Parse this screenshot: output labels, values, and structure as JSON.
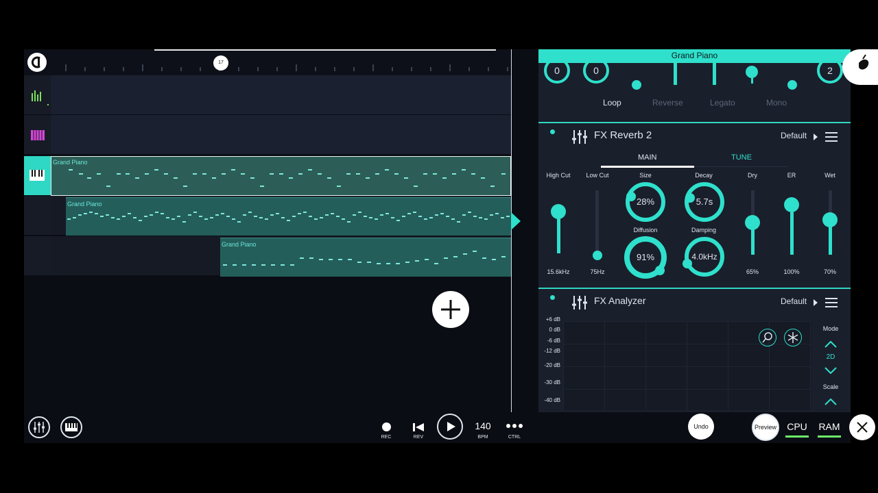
{
  "timeline": {
    "bar_marker": "17"
  },
  "playlist": {
    "clips": [
      {
        "label": "Grand Piano"
      },
      {
        "label": "Grand Piano"
      },
      {
        "label": "Grand Piano"
      }
    ]
  },
  "channel": {
    "title": "Grand Piano",
    "knob1": "0",
    "knob2": "0",
    "knob3": "2",
    "toggles": [
      "Loop",
      "Reverse",
      "Legato",
      "Mono"
    ]
  },
  "reverb": {
    "title": "FX Reverb 2",
    "preset": "Default",
    "tabs": [
      "MAIN",
      "TUNE"
    ],
    "high_cut": {
      "label": "High Cut",
      "value": "15.6kHz"
    },
    "low_cut": {
      "label": "Low Cut",
      "value": "75Hz"
    },
    "size": {
      "label": "Size",
      "value": "28%"
    },
    "decay": {
      "label": "Decay",
      "value": "5.7s"
    },
    "diffusion": {
      "label": "Diffusion",
      "value": "91%"
    },
    "damping": {
      "label": "Damping",
      "value": "4.0kHz"
    },
    "dry": {
      "label": "Dry",
      "value": "65%"
    },
    "er": {
      "label": "ER",
      "value": "100%"
    },
    "wet": {
      "label": "Wet",
      "value": "70%"
    }
  },
  "analyzer": {
    "title": "FX Analyzer",
    "preset": "Default",
    "db_labels": [
      "+6 dB",
      "0 dB",
      "-6 dB",
      "-12 dB",
      "-20 dB",
      "-30 dB",
      "-40 dB"
    ],
    "mode_label": "Mode",
    "mode_value": "2D",
    "scale_label": "Scale"
  },
  "transport": {
    "rec": "REC",
    "rev": "REV",
    "bpm_value": "140",
    "bpm": "BPM",
    "ctrl": "CTRL",
    "undo": "Undo",
    "preview": "Preview",
    "cpu": "CPU",
    "ram": "RAM"
  },
  "colors": {
    "accent": "#2fe0cc",
    "bg": "#0b0d14",
    "panel": "#1a1f2c"
  }
}
